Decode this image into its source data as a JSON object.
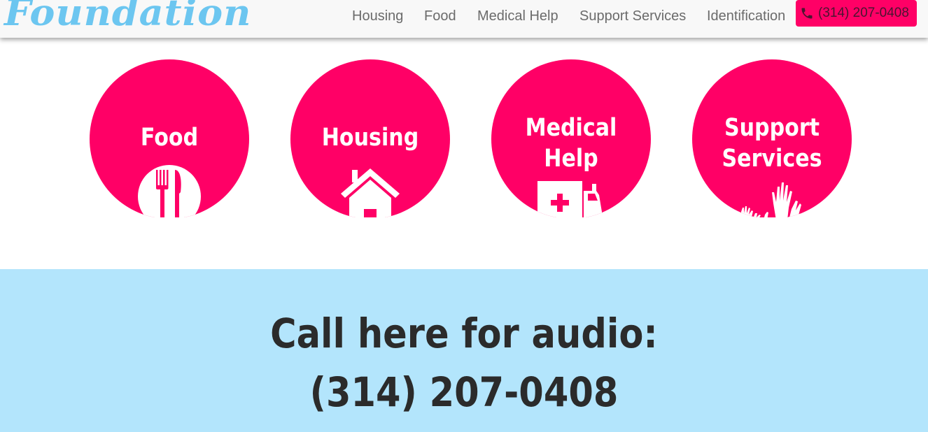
{
  "header": {
    "logo": "Foundation",
    "nav": [
      "Housing",
      "Food",
      "Medical Help",
      "Support Services",
      "Identification"
    ],
    "phone": "(314) 207-0408"
  },
  "services": [
    {
      "label_lines": [
        "Food"
      ],
      "icon": "fork-knife-icon"
    },
    {
      "label_lines": [
        "Housing"
      ],
      "icon": "house-icon"
    },
    {
      "label_lines": [
        "Medical",
        "Help"
      ],
      "icon": "ambulance-icon"
    },
    {
      "label_lines": [
        "Support",
        "Services"
      ],
      "icon": "raised-hands-icon"
    }
  ],
  "audio": {
    "heading": "Call here for audio:",
    "phone": "(314) 207-0408"
  },
  "colors": {
    "accent": "#ff0066",
    "logo": "#6cc6f0",
    "band": "#b3e5fc"
  }
}
